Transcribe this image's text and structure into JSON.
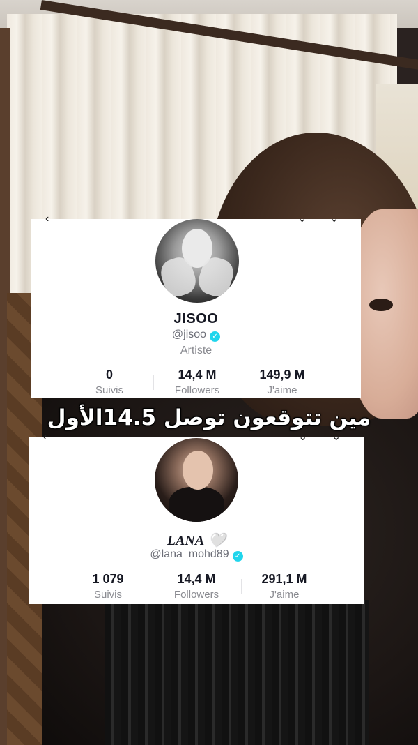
{
  "caption": "مين تتوقعون توصل 14.5الأول",
  "profiles": [
    {
      "display_name": "JISOO",
      "username": "@jisoo",
      "category": "Artiste",
      "stats": [
        {
          "value": "0",
          "label": "Suivis"
        },
        {
          "value": "14,4 M",
          "label": "Followers"
        },
        {
          "value": "149,9 M",
          "label": "J'aime"
        }
      ]
    },
    {
      "display_name": "LANA",
      "username": "@lana_mohd89",
      "stats": [
        {
          "value": "1 079",
          "label": "Suivis"
        },
        {
          "value": "14,4 M",
          "label": "Followers"
        },
        {
          "value": "291,1 M",
          "label": "J'aime"
        }
      ]
    }
  ],
  "icons": {
    "verified": "verified-badge-icon",
    "heart": "white-heart-icon",
    "heart_glyph": "🤍",
    "check_glyph": "✓"
  },
  "colors": {
    "verified": "#20d5ec",
    "primary_text": "#161823",
    "secondary_text": "#8a8b91"
  }
}
